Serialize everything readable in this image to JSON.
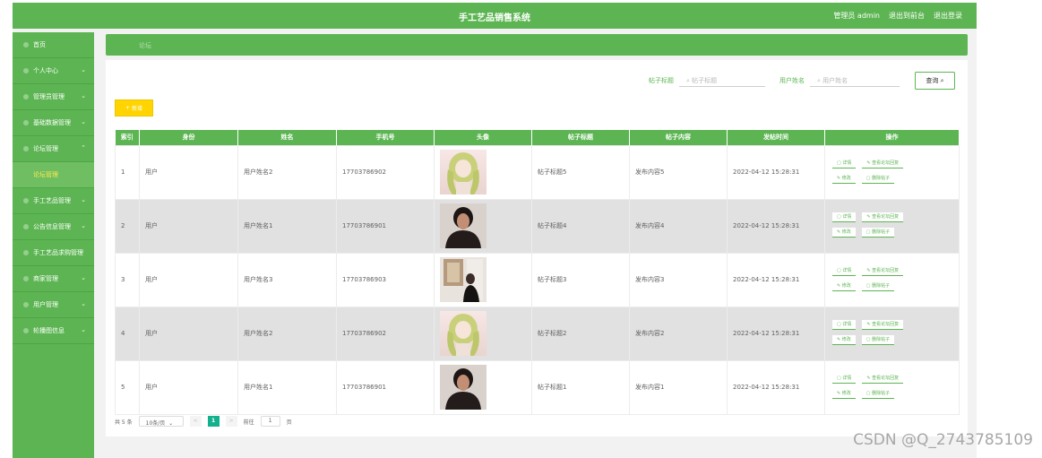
{
  "header": {
    "title": "手工艺品销售系统",
    "user_label": "管理员 admin",
    "front_label": "退出到前台",
    "logout_label": "退出登录"
  },
  "sidebar": {
    "items": [
      {
        "label": "首页",
        "chevron": ""
      },
      {
        "label": "个人中心",
        "chevron": "⌄"
      },
      {
        "label": "管理员管理",
        "chevron": "⌄"
      },
      {
        "label": "基础数据管理",
        "chevron": "⌄"
      },
      {
        "label": "论坛管理",
        "chevron": "⌃"
      },
      {
        "label": "论坛管理",
        "chevron": ""
      },
      {
        "label": "手工艺品管理",
        "chevron": "⌄"
      },
      {
        "label": "公告信息管理",
        "chevron": "⌄"
      },
      {
        "label": "手工艺品求购管理",
        "chevron": ""
      },
      {
        "label": "商家管理",
        "chevron": "⌄"
      },
      {
        "label": "用户管理",
        "chevron": "⌄"
      },
      {
        "label": "轮播图信息",
        "chevron": "⌄"
      }
    ]
  },
  "breadcrumb": "论坛",
  "search": {
    "title_label": "帖子标题",
    "title_placeholder": "帖子标题",
    "user_label": "用户姓名",
    "user_placeholder": "用户姓名",
    "query_label": "查询"
  },
  "add_label": "新增",
  "table": {
    "columns": [
      "索引",
      "身份",
      "姓名",
      "手机号",
      "头像",
      "帖子标题",
      "帖子内容",
      "发帖时间",
      "操作"
    ],
    "rows": [
      {
        "index": "1",
        "role": "用户",
        "name": "用户姓名2",
        "phone": "17703786902",
        "avatar": "anime",
        "title": "帖子标题5",
        "content": "发布内容5",
        "time": "2022-04-12 15:28:31"
      },
      {
        "index": "2",
        "role": "用户",
        "name": "用户姓名1",
        "phone": "17703786901",
        "avatar": "man",
        "title": "帖子标题4",
        "content": "发布内容4",
        "time": "2022-04-12 15:28:31"
      },
      {
        "index": "3",
        "role": "用户",
        "name": "用户姓名3",
        "phone": "17703786903",
        "avatar": "room",
        "title": "帖子标题3",
        "content": "发布内容3",
        "time": "2022-04-12 15:28:31"
      },
      {
        "index": "4",
        "role": "用户",
        "name": "用户姓名2",
        "phone": "17703786902",
        "avatar": "anime",
        "title": "帖子标题2",
        "content": "发布内容2",
        "time": "2022-04-12 15:28:31"
      },
      {
        "index": "5",
        "role": "用户",
        "name": "用户姓名1",
        "phone": "17703786901",
        "avatar": "man",
        "title": "帖子标题1",
        "content": "发布内容1",
        "time": "2022-04-12 15:28:31"
      }
    ],
    "actions": {
      "detail": "详情",
      "view_reply": "查看论坛回复",
      "edit": "修改",
      "delete": "删除帖子"
    }
  },
  "pagination": {
    "total": "共 5 条",
    "page_size": "10条/页",
    "prev": "<",
    "current": "1",
    "next": ">",
    "goto_label": "前往",
    "goto_value": "1",
    "page_suffix": "页"
  },
  "watermark": "CSDN @Q_2743785109",
  "colors": {
    "accent": "#5cb552",
    "add_button": "#ffd400",
    "page_current": "#12b08d"
  }
}
